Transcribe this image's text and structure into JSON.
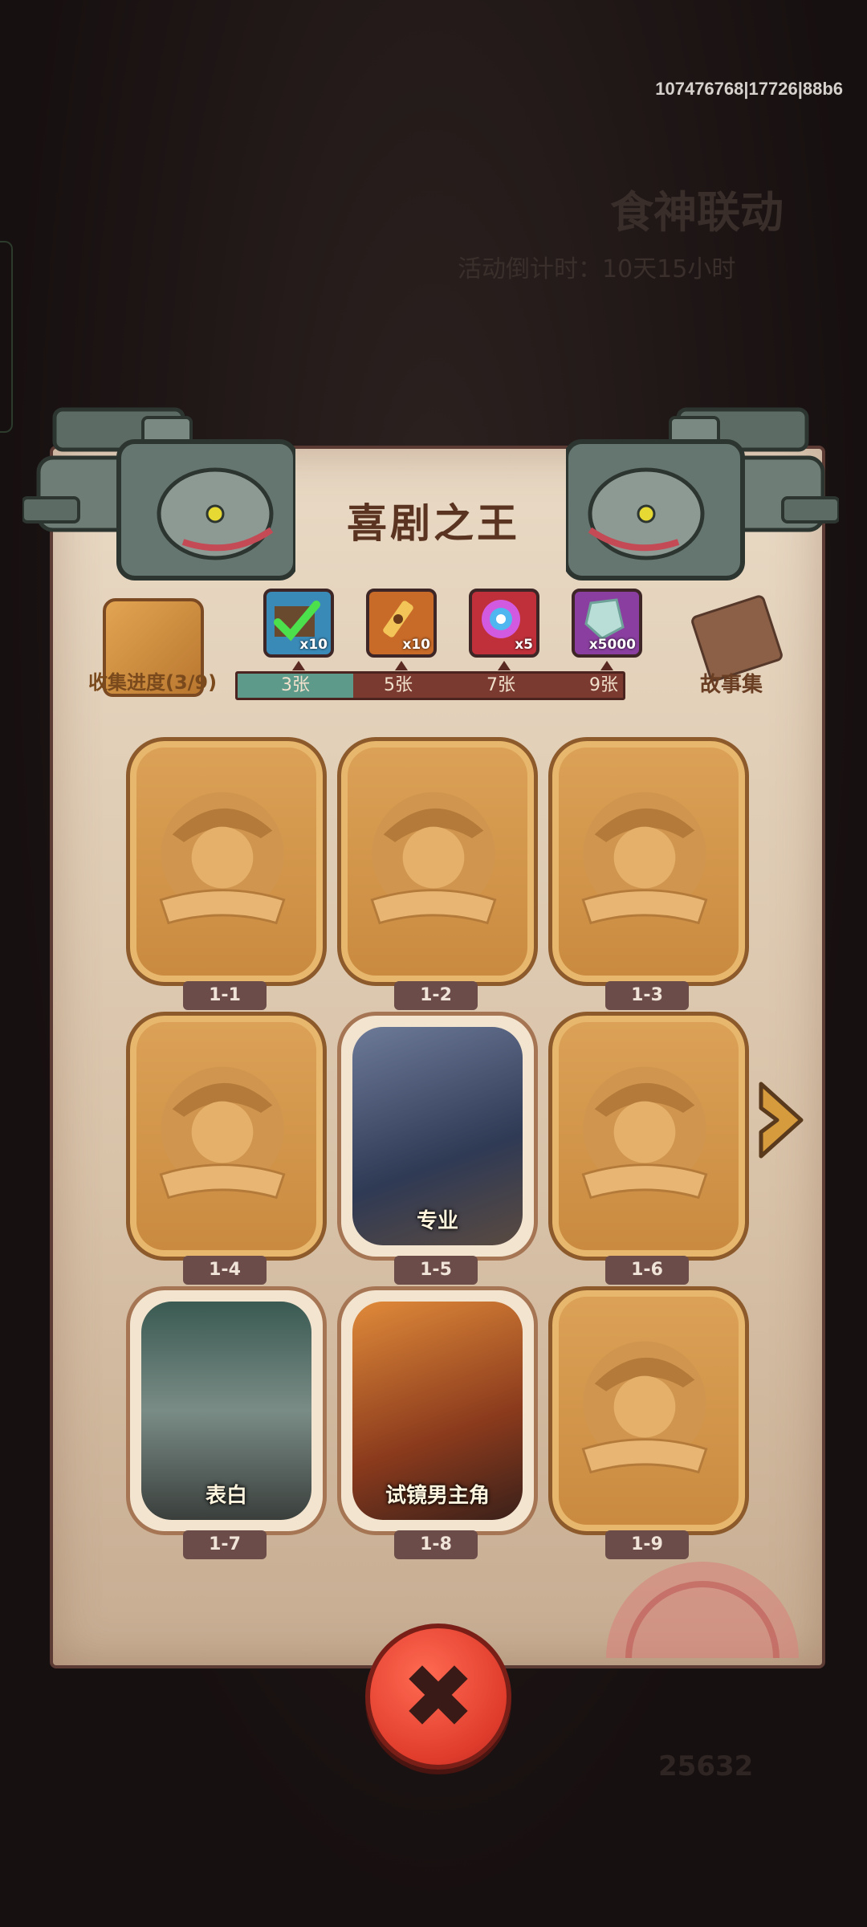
{
  "debug": {
    "id_text": "107476768|17726|88b6"
  },
  "background": {
    "event_title": "食神联动",
    "countdown": "活动倒计时：10天15小时",
    "score": "25632"
  },
  "panel": {
    "title": "喜剧之王",
    "progress_label": "收集进度(3/9)",
    "progress": {
      "collected": 3,
      "total": 9
    },
    "story_label": "故事集"
  },
  "rewards": [
    {
      "icon": "chest-check-icon",
      "count": "x10",
      "threshold": "3张",
      "color": "#3a8ab8"
    },
    {
      "icon": "golden-key-icon",
      "count": "x10",
      "threshold": "5张",
      "color": "#c86a28"
    },
    {
      "icon": "magic-orb-icon",
      "count": "x5",
      "threshold": "7张",
      "color": "#c0303a"
    },
    {
      "icon": "crystal-icon",
      "count": "x5000",
      "threshold": "9张",
      "color": "#8a3fa0"
    }
  ],
  "cards": [
    {
      "id": "1-1",
      "unlocked": false,
      "caption": ""
    },
    {
      "id": "1-2",
      "unlocked": false,
      "caption": ""
    },
    {
      "id": "1-3",
      "unlocked": false,
      "caption": ""
    },
    {
      "id": "1-4",
      "unlocked": false,
      "caption": ""
    },
    {
      "id": "1-5",
      "unlocked": true,
      "caption": "专业"
    },
    {
      "id": "1-6",
      "unlocked": false,
      "caption": ""
    },
    {
      "id": "1-7",
      "unlocked": true,
      "caption": "表白"
    },
    {
      "id": "1-8",
      "unlocked": true,
      "caption": "试镜男主角"
    },
    {
      "id": "1-9",
      "unlocked": false,
      "caption": ""
    }
  ],
  "close_label": "✖"
}
